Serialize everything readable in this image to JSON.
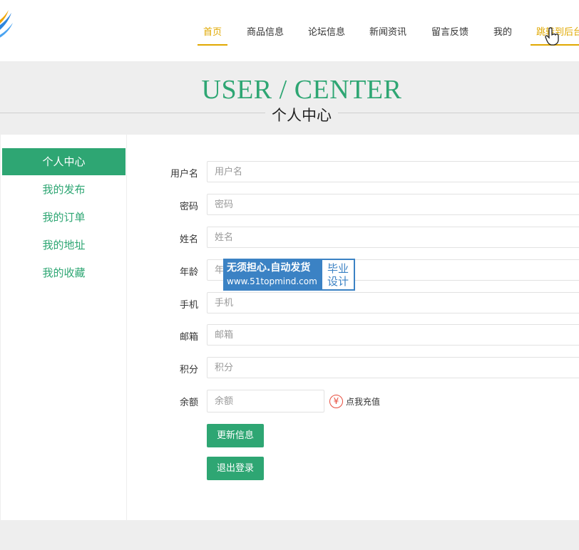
{
  "nav": {
    "items": [
      {
        "label": "首页"
      },
      {
        "label": "商品信息"
      },
      {
        "label": "论坛信息"
      },
      {
        "label": "新闻资讯"
      },
      {
        "label": "留言反馈"
      },
      {
        "label": "我的"
      },
      {
        "label": "跳转到后台"
      }
    ]
  },
  "banner": {
    "title_en": "USER / CENTER",
    "title_cn": "个人中心"
  },
  "sidebar": {
    "items": [
      {
        "label": "个人中心"
      },
      {
        "label": "我的发布"
      },
      {
        "label": "我的订单"
      },
      {
        "label": "我的地址"
      },
      {
        "label": "我的收藏"
      }
    ]
  },
  "form": {
    "fields": [
      {
        "label": "用户名",
        "placeholder": "用户名",
        "value": ""
      },
      {
        "label": "密码",
        "placeholder": "密码",
        "value": ""
      },
      {
        "label": "姓名",
        "placeholder": "姓名",
        "value": ""
      },
      {
        "label": "年龄",
        "placeholder": "年龄",
        "value": ""
      },
      {
        "label": "手机",
        "placeholder": "手机",
        "value": ""
      },
      {
        "label": "邮箱",
        "placeholder": "邮箱",
        "value": ""
      },
      {
        "label": "积分",
        "placeholder": "积分",
        "value": ""
      },
      {
        "label": "余额",
        "placeholder": "余额",
        "value": ""
      }
    ],
    "recharge_icon": "¥",
    "recharge_label": "点我充值",
    "update_button": "更新信息",
    "logout_button": "退出登录"
  },
  "watermark": {
    "line1": "无须担心.自动发货",
    "line2": "www.51topmind.com",
    "right1": "毕业",
    "right2": "设计"
  },
  "colors": {
    "accent": "#2ea673",
    "nav_active": "#e0a800",
    "banner_bg": "#eeeeee",
    "watermark_blue": "#3b82c4"
  },
  "icons": [
    "logo-icon",
    "hand-cursor-icon",
    "yen-icon"
  ]
}
